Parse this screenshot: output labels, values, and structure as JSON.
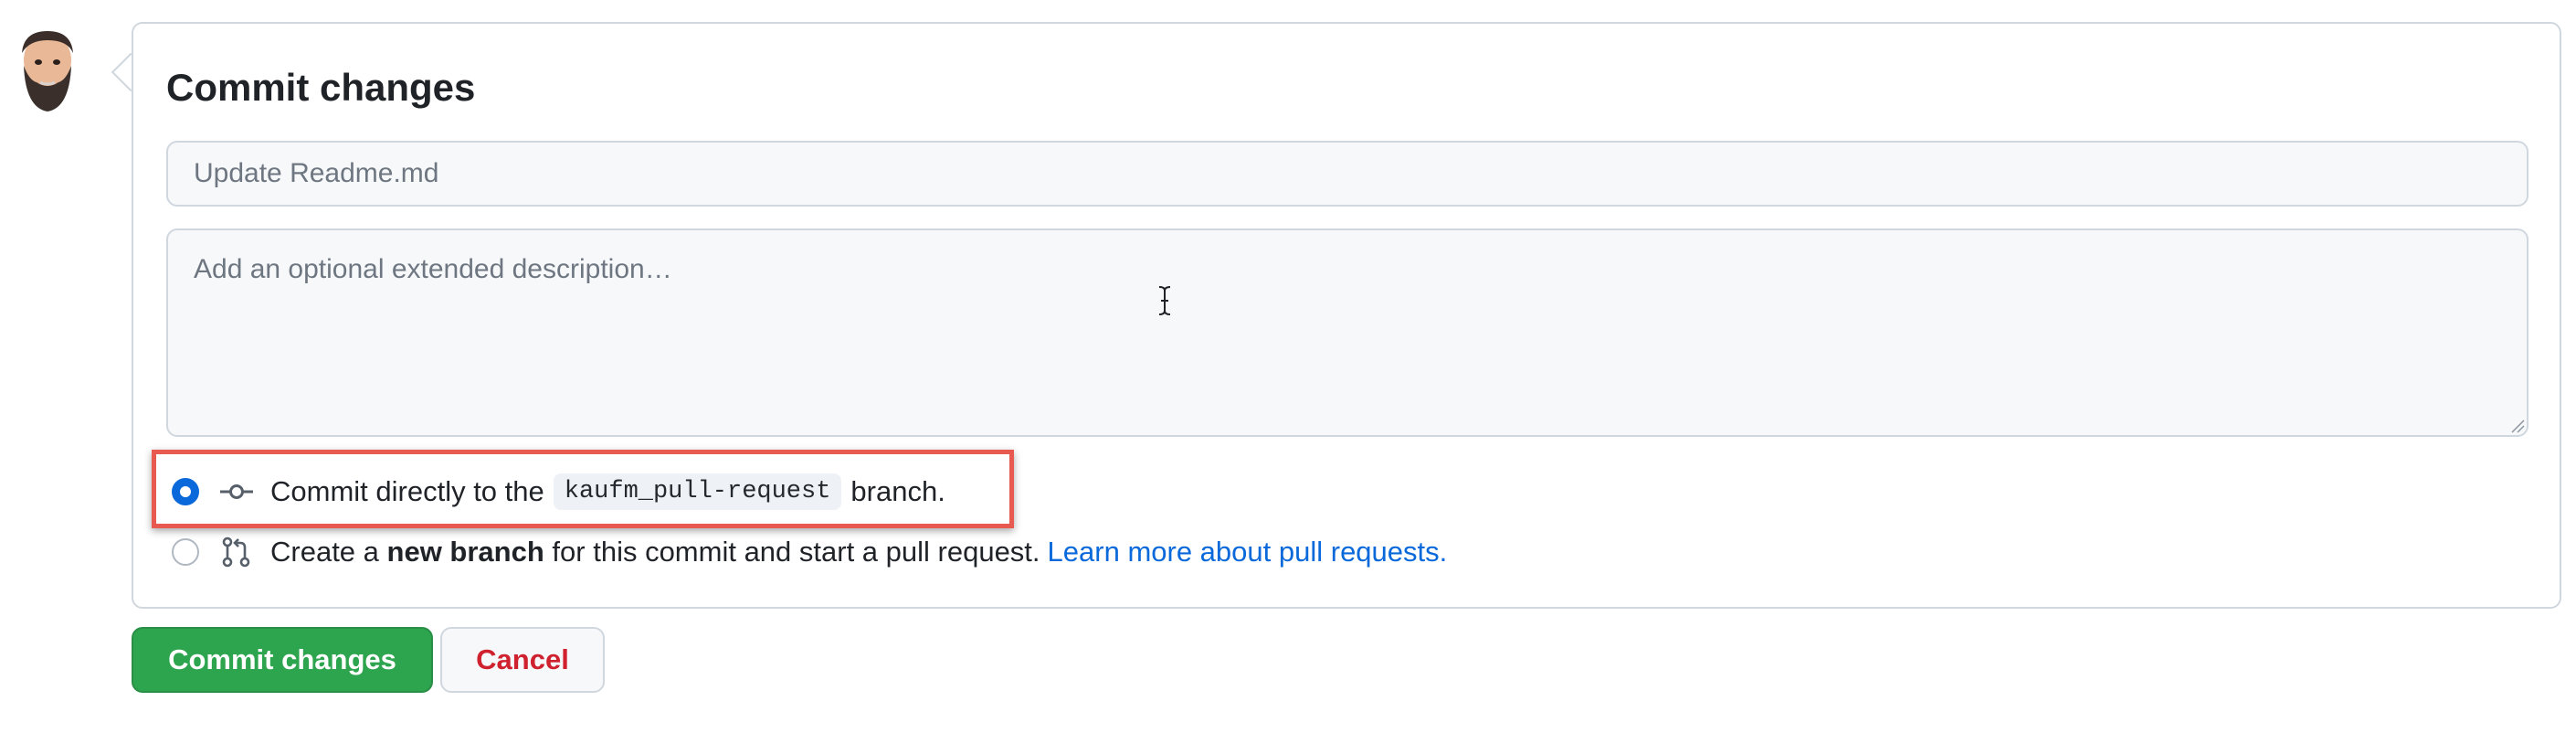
{
  "user": {
    "avatar_icon": "user-avatar"
  },
  "commit_form": {
    "title": "Commit changes",
    "summary_placeholder": "Update Readme.md",
    "description_placeholder": "Add an optional extended description…",
    "options": {
      "direct": {
        "prefix": "Commit directly to the",
        "branch": "kaufm_pull-request",
        "suffix": "branch.",
        "selected": true,
        "icon": "git-commit-icon"
      },
      "new_branch": {
        "prefix": "Create a",
        "bold": "new branch",
        "suffix": "for this commit and start a pull request.",
        "link": "Learn more about pull requests.",
        "selected": false,
        "icon": "git-pull-request-icon"
      }
    },
    "buttons": {
      "commit": "Commit changes",
      "cancel": "Cancel"
    }
  },
  "colors": {
    "primary_button": "#2da44e",
    "link": "#0969da",
    "danger_text": "#cf222e",
    "highlight_border": "#e8594f"
  }
}
